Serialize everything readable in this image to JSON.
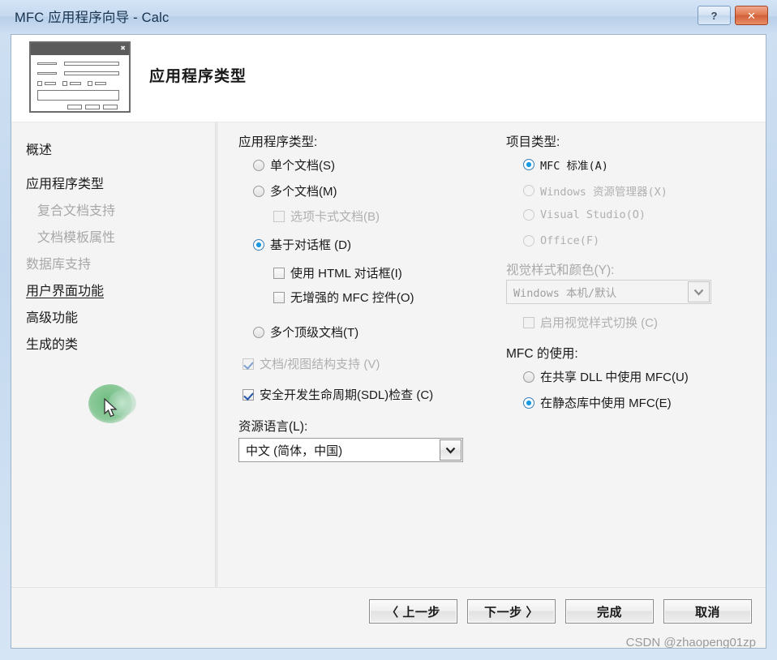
{
  "window": {
    "title": "MFC 应用程序向导 - Calc",
    "help_button": "?",
    "close_button": "✕"
  },
  "header": {
    "title": "应用程序类型",
    "icon": "dialog-preview-icon"
  },
  "sidebar": {
    "items": [
      {
        "label": "概述",
        "state": "normal",
        "indent": 0
      },
      {
        "label": "应用程序类型",
        "state": "normal",
        "indent": 0
      },
      {
        "label": "复合文档支持",
        "state": "disabled",
        "indent": 1
      },
      {
        "label": "文档模板属性",
        "state": "disabled",
        "indent": 1
      },
      {
        "label": "数据库支持",
        "state": "disabled",
        "indent": 0
      },
      {
        "label": "用户界面功能",
        "state": "active-link",
        "indent": 0
      },
      {
        "label": "高级功能",
        "state": "normal",
        "indent": 0
      },
      {
        "label": "生成的类",
        "state": "normal",
        "indent": 0
      }
    ]
  },
  "left_column": {
    "app_type_label": "应用程序类型:",
    "options": [
      {
        "label": "单个文档(S)",
        "checked": false,
        "disabled": false
      },
      {
        "label": "多个文档(M)",
        "checked": false,
        "disabled": false
      },
      {
        "label": "基于对话框 (D)",
        "checked": true,
        "disabled": false
      },
      {
        "label": "多个顶级文档(T)",
        "checked": false,
        "disabled": false
      }
    ],
    "tabbed_document": {
      "label": "选项卡式文档(B)",
      "checked": false,
      "disabled": true
    },
    "html_dialog": {
      "label": "使用 HTML 对话框(I)",
      "checked": false,
      "disabled": false
    },
    "no_enhanced_mfc": {
      "label": "无增强的 MFC 控件(O)",
      "checked": false,
      "disabled": false
    },
    "doc_view_support": {
      "label": "文档/视图结构支持 (V)",
      "checked": true,
      "disabled": true
    },
    "sdl_check": {
      "label": "安全开发生命周期(SDL)检查 (C)",
      "checked": true,
      "disabled": false
    },
    "resource_language_label": "资源语言(L):",
    "resource_language_value": "中文 (简体，中国)"
  },
  "right_column": {
    "project_type_label": "项目类型:",
    "project_types": [
      {
        "label": "MFC 标准(A)",
        "checked": true,
        "disabled": false
      },
      {
        "label": "Windows 资源管理器(X)",
        "checked": false,
        "disabled": true
      },
      {
        "label": "Visual Studio(O)",
        "checked": false,
        "disabled": true
      },
      {
        "label": "Office(F)",
        "checked": false,
        "disabled": true
      }
    ],
    "visual_style_label": "视觉样式和颜色(Y):",
    "visual_style_value": "Windows 本机/默认",
    "enable_style_switch": {
      "label": "启用视觉样式切换 (C)",
      "checked": false,
      "disabled": true
    },
    "mfc_usage_label": "MFC 的使用:",
    "mfc_usage_options": [
      {
        "label": "在共享 DLL 中使用 MFC(U)",
        "checked": false,
        "disabled": false
      },
      {
        "label": "在静态库中使用 MFC(E)",
        "checked": true,
        "disabled": false
      }
    ]
  },
  "footer": {
    "back": "〈 上一步",
    "next": "下一步 〉",
    "finish": "完成",
    "cancel": "取消"
  },
  "watermark": "CSDN @zhaopeng01zp",
  "colors": {
    "accent": "#1a9ae0",
    "titlebar": "#c6d9ef",
    "close_button": "#d2603a",
    "click_highlight": "#56b26a"
  }
}
